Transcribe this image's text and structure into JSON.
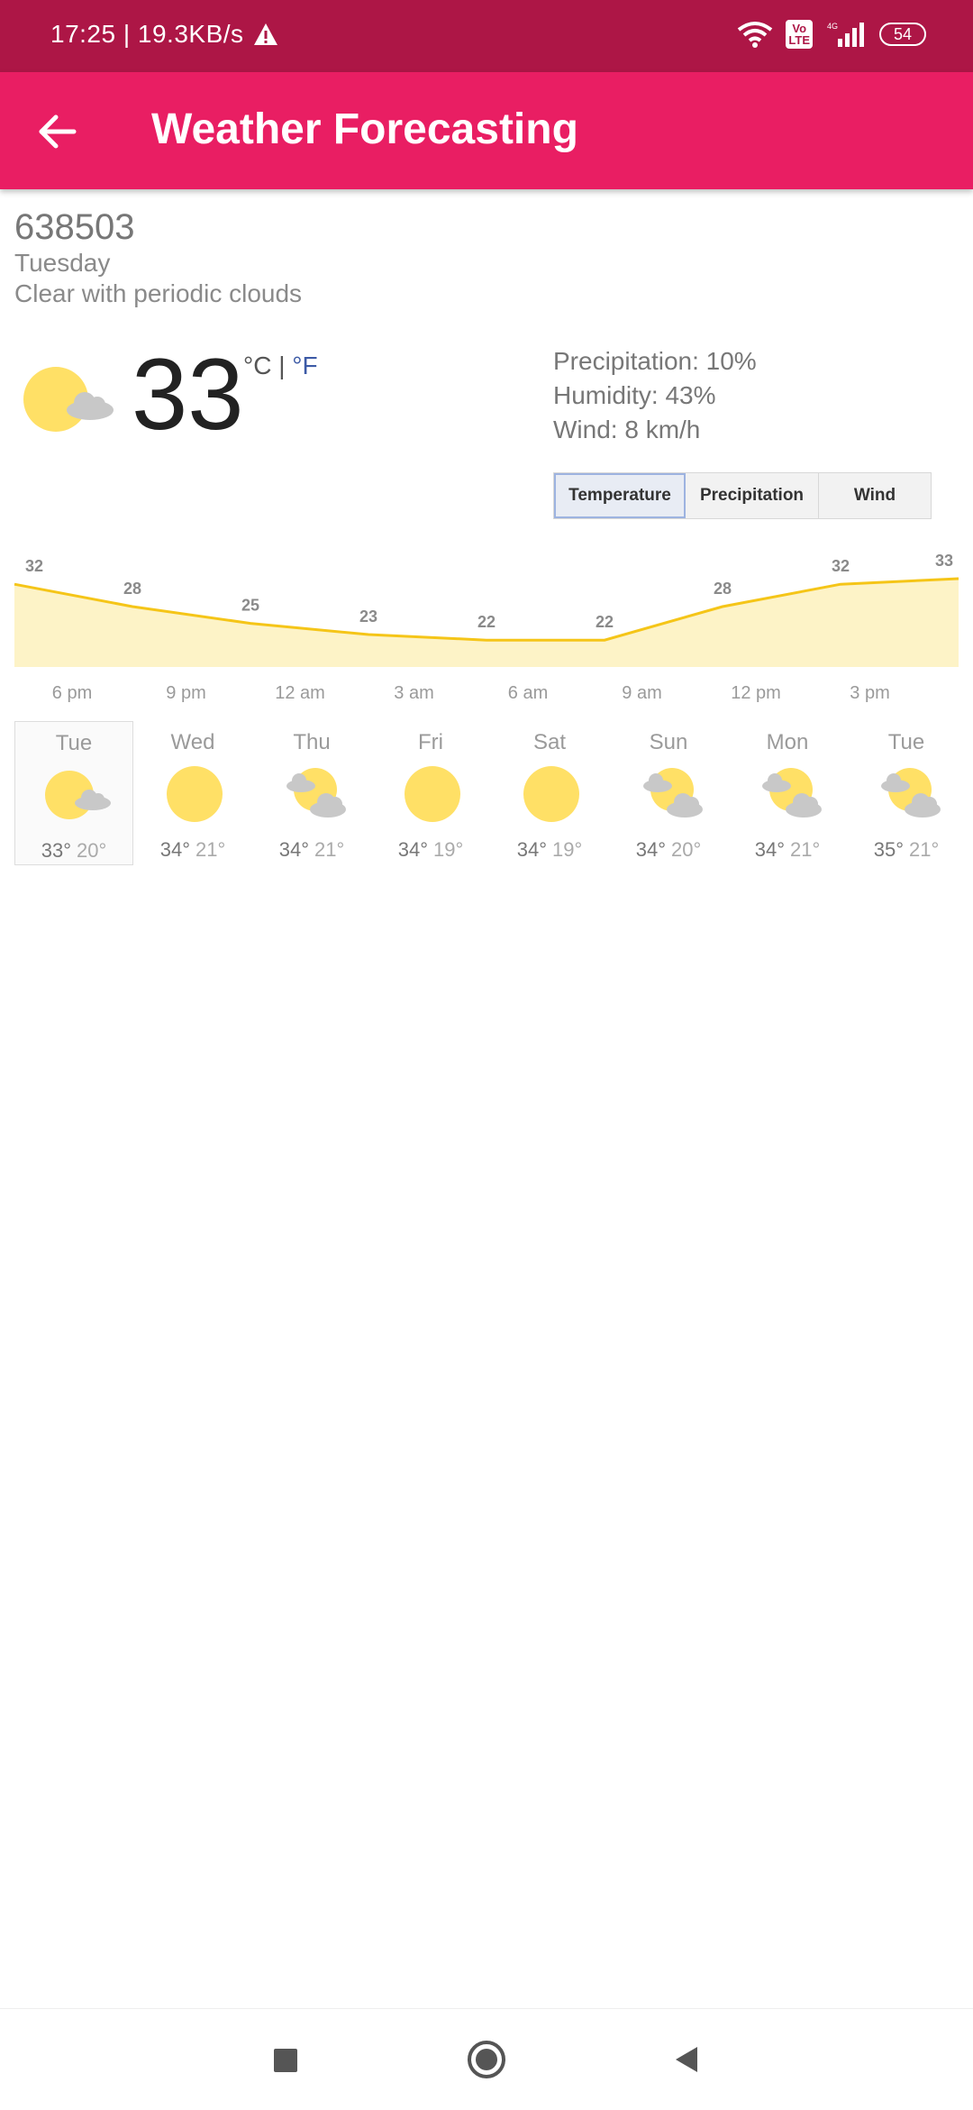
{
  "status_bar": {
    "time_speed": "17:25 | 19.3KB/s",
    "volte": "Vo\nLTE",
    "network": "4G",
    "battery": "54"
  },
  "app_bar": {
    "title": "Weather Forecasting"
  },
  "weather": {
    "location": "638503",
    "day": "Tuesday",
    "condition": "Clear with periodic clouds",
    "temperature": "33",
    "unit_c": "°C",
    "unit_sep": " | ",
    "unit_f": "°F",
    "precipitation": "Precipitation: 10%",
    "humidity": "Humidity: 43%",
    "wind": "Wind: 8 km/h"
  },
  "tabs": [
    {
      "label": "Temperature",
      "active": true
    },
    {
      "label": "Precipitation",
      "active": false
    },
    {
      "label": "Wind",
      "active": false
    }
  ],
  "chart_data": {
    "type": "area",
    "values": [
      32,
      28,
      25,
      23,
      22,
      22,
      28,
      32,
      33
    ],
    "x_labels": [
      "6 pm",
      "9 pm",
      "12 am",
      "3 am",
      "6 am",
      "9 am",
      "12 pm",
      "3 pm"
    ],
    "line_color": "#f5c518",
    "fill_color": "#fdf3c7"
  },
  "forecast": [
    {
      "day": "Tue",
      "hi": "33°",
      "lo": "20°",
      "icon": "partly-sunny-icon",
      "selected": true
    },
    {
      "day": "Wed",
      "hi": "34°",
      "lo": "21°",
      "icon": "sun-icon",
      "selected": false
    },
    {
      "day": "Thu",
      "hi": "34°",
      "lo": "21°",
      "icon": "sun-cloud-icon",
      "selected": false
    },
    {
      "day": "Fri",
      "hi": "34°",
      "lo": "19°",
      "icon": "sun-icon",
      "selected": false
    },
    {
      "day": "Sat",
      "hi": "34°",
      "lo": "19°",
      "icon": "sun-icon",
      "selected": false
    },
    {
      "day": "Sun",
      "hi": "34°",
      "lo": "20°",
      "icon": "sun-cloud-icon",
      "selected": false
    },
    {
      "day": "Mon",
      "hi": "34°",
      "lo": "21°",
      "icon": "sun-cloud-icon",
      "selected": false
    },
    {
      "day": "Tue",
      "hi": "35°",
      "lo": "21°",
      "icon": "sun-cloud-icon",
      "selected": false
    }
  ],
  "colors": {
    "status_bar": "#ad1646",
    "app_bar": "#e91e63",
    "sun": "#ffe066",
    "cloud": "#c8c8c8"
  }
}
